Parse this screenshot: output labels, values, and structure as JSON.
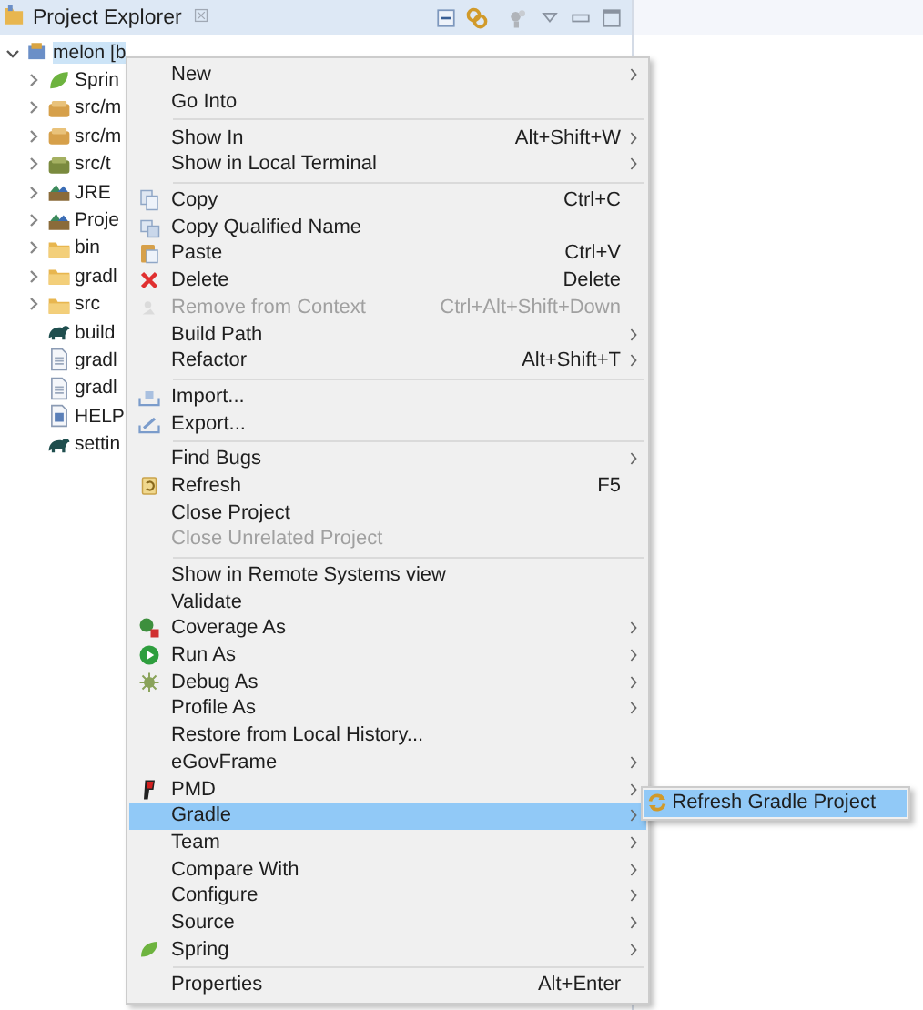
{
  "view": {
    "title": "Project Explorer"
  },
  "tree": {
    "label": "melon [b",
    "kind": "project",
    "expanded": true,
    "selected": true,
    "children": [
      {
        "label": "Sprin",
        "kind": "spring",
        "expanded": false
      },
      {
        "label": "src/m",
        "kind": "package",
        "expanded": false
      },
      {
        "label": "src/m",
        "kind": "package",
        "expanded": false
      },
      {
        "label": "src/t",
        "kind": "package-test",
        "expanded": false
      },
      {
        "label": "JRE",
        "kind": "library",
        "expanded": false
      },
      {
        "label": "Proje",
        "kind": "library",
        "expanded": false
      },
      {
        "label": "bin",
        "kind": "folder",
        "expanded": false
      },
      {
        "label": "gradl",
        "kind": "folder",
        "expanded": false
      },
      {
        "label": "src",
        "kind": "folder",
        "expanded": false
      },
      {
        "label": "build",
        "kind": "gradle"
      },
      {
        "label": "gradl",
        "kind": "file"
      },
      {
        "label": "gradl",
        "kind": "file"
      },
      {
        "label": "HELP",
        "kind": "doc"
      },
      {
        "label": "settin",
        "kind": "gradle"
      }
    ]
  },
  "context_menu": {
    "groups": [
      [
        {
          "label": "New",
          "submenu": true
        },
        {
          "label": "Go Into"
        }
      ],
      [
        {
          "label": "Show In",
          "shortcut": "Alt+Shift+W",
          "submenu": true
        },
        {
          "label": "Show in Local Terminal",
          "submenu": true
        }
      ],
      [
        {
          "label": "Copy",
          "shortcut": "Ctrl+C",
          "kind": "copy"
        },
        {
          "label": "Copy Qualified Name",
          "kind": "copy-qualified"
        },
        {
          "label": "Paste",
          "shortcut": "Ctrl+V",
          "kind": "paste"
        },
        {
          "label": "Delete",
          "shortcut": "Delete",
          "kind": "delete"
        },
        {
          "label": "Remove from Context",
          "shortcut": "Ctrl+Alt+Shift+Down",
          "kind": "remove",
          "disabled": true
        },
        {
          "label": "Build Path",
          "submenu": true
        },
        {
          "label": "Refactor",
          "shortcut": "Alt+Shift+T",
          "submenu": true
        }
      ],
      [
        {
          "label": "Import...",
          "kind": "import"
        },
        {
          "label": "Export...",
          "kind": "export"
        }
      ],
      [
        {
          "label": "Find Bugs",
          "submenu": true
        },
        {
          "label": "Refresh",
          "shortcut": "F5",
          "kind": "refresh"
        },
        {
          "label": "Close Project"
        },
        {
          "label": "Close Unrelated Project",
          "disabled": true
        }
      ],
      [
        {
          "label": "Show in Remote Systems view"
        },
        {
          "label": "Validate"
        },
        {
          "label": "Coverage As",
          "kind": "coverage",
          "submenu": true
        },
        {
          "label": "Run As",
          "kind": "run",
          "submenu": true
        },
        {
          "label": "Debug As",
          "kind": "debug",
          "submenu": true
        },
        {
          "label": "Profile As",
          "submenu": true
        },
        {
          "label": "Restore from Local History..."
        },
        {
          "label": "eGovFrame",
          "submenu": true
        },
        {
          "label": "PMD",
          "kind": "pmd",
          "submenu": true
        },
        {
          "label": "Gradle",
          "submenu": true,
          "selected": true
        },
        {
          "label": "Team",
          "submenu": true
        },
        {
          "label": "Compare With",
          "submenu": true
        },
        {
          "label": "Configure",
          "submenu": true
        },
        {
          "label": "Source",
          "submenu": true
        },
        {
          "label": "Spring",
          "kind": "spring",
          "submenu": true
        }
      ],
      [
        {
          "label": "Properties",
          "shortcut": "Alt+Enter"
        }
      ]
    ]
  },
  "submenu": {
    "items": [
      {
        "label": "Refresh Gradle Project",
        "kind": "gradle-refresh",
        "selected": true
      }
    ]
  }
}
